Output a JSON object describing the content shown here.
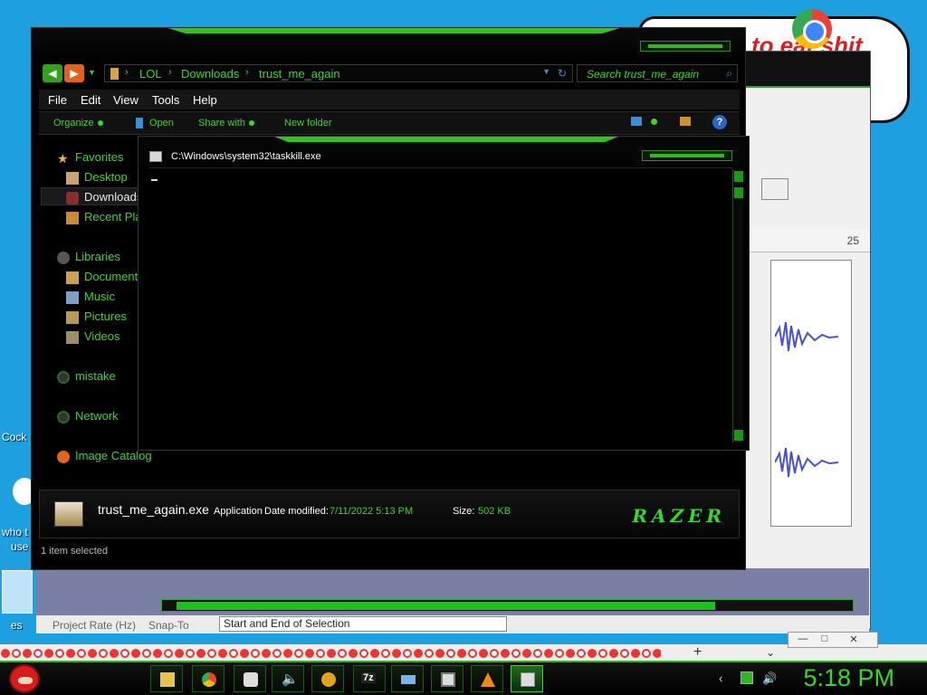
{
  "background": {
    "doodle_text": "to eat shit",
    "desktop_labels": [
      "Cock",
      "who t",
      "use",
      "es"
    ]
  },
  "audacity": {
    "ruler_tick": "25",
    "footer_project_rate": "Project Rate (Hz)",
    "footer_snap_to": "Snap-To",
    "selection_mode": "Start and End of Selection"
  },
  "explorer": {
    "nav": {
      "back": "◀",
      "forward": "▶",
      "breadcrumbs": [
        "LOL",
        "Downloads",
        "trust_me_again"
      ],
      "search_placeholder": "Search trust_me_again"
    },
    "menu": [
      "File",
      "Edit",
      "View",
      "Tools",
      "Help"
    ],
    "toolbar": {
      "organize": "Organize",
      "open": "Open",
      "share_with": "Share with",
      "new_folder": "New folder",
      "help": "?"
    },
    "nav_pane": {
      "favorites": "Favorites",
      "desktop": "Desktop",
      "downloads": "Downloads",
      "recent_places": "Recent Pla",
      "libraries": "Libraries",
      "documents": "Document",
      "music": "Music",
      "pictures": "Pictures",
      "videos": "Videos",
      "mistake": "mistake",
      "network": "Network",
      "image_catalog": "Image Catalog"
    },
    "details": {
      "file_name": "trust_me_again.exe",
      "file_type": "Application",
      "date_label": "Date modified:",
      "date_value": "7/11/2022 5:13 PM",
      "size_label": "Size:",
      "size_value": "502 KB",
      "brand": "RAZER"
    },
    "status": "1 item selected"
  },
  "console": {
    "title": "C:\\Windows\\system32\\taskkill.exe"
  },
  "taskbar": {
    "apps": [
      "file-explorer",
      "chrome",
      "media",
      "volume-mixer",
      "app",
      "7zip",
      "keyboard",
      "remote-desktop",
      "vlc",
      "console"
    ],
    "clock": "5:18 PM"
  },
  "colors": {
    "accent_green": "#3ad62b",
    "desktop_blue": "#1e9fe0"
  }
}
